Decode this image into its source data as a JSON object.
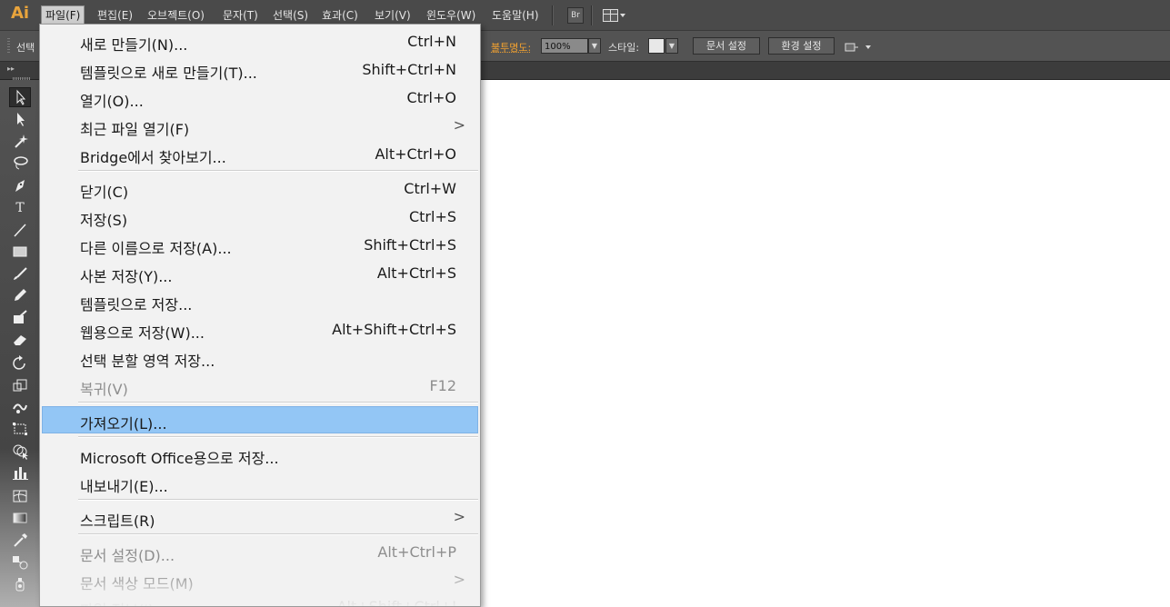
{
  "app": {
    "logo": "Ai"
  },
  "menubar": {
    "items": [
      "파일(F)",
      "편집(E)",
      "오브젝트(O)",
      "문자(T)",
      "선택(S)",
      "효과(C)",
      "보기(V)",
      "윈도우(W)",
      "도움말(H)"
    ],
    "bridge_button": "Br",
    "workspace_icon": "layout-icon"
  },
  "controlbar": {
    "selection_label": "선택",
    "opacity_label": "불투명도:",
    "opacity_value": "100%",
    "style_label": "스타일:",
    "document_setup": "문서 설정",
    "preferences": "환경 설정",
    "arrange_icon": "arrange-icon"
  },
  "file_menu": {
    "items": [
      {
        "label": "새로 만들기(N)...",
        "shortcut": "Ctrl+N"
      },
      {
        "label": "템플릿으로 새로 만들기(T)...",
        "shortcut": "Shift+Ctrl+N"
      },
      {
        "label": "열기(O)...",
        "shortcut": "Ctrl+O"
      },
      {
        "label": "최근 파일 열기(F)",
        "shortcut": "",
        "submenu": ">"
      },
      {
        "label": "Bridge에서 찾아보기...",
        "shortcut": "Alt+Ctrl+O"
      },
      {
        "label": "닫기(C)",
        "shortcut": "Ctrl+W"
      },
      {
        "label": "저장(S)",
        "shortcut": "Ctrl+S"
      },
      {
        "label": "다른 이름으로 저장(A)...",
        "shortcut": "Shift+Ctrl+S"
      },
      {
        "label": "사본 저장(Y)...",
        "shortcut": "Alt+Ctrl+S"
      },
      {
        "label": "템플릿으로 저장...",
        "shortcut": ""
      },
      {
        "label": "웹용으로 저장(W)...",
        "shortcut": "Alt+Shift+Ctrl+S"
      },
      {
        "label": "선택 분할 영역 저장...",
        "shortcut": ""
      },
      {
        "label": "복귀(V)",
        "shortcut": "F12",
        "disabled": true
      },
      {
        "label": "가져오기(L)...",
        "shortcut": "",
        "highlighted": true
      },
      {
        "label": "Microsoft Office용으로 저장...",
        "shortcut": ""
      },
      {
        "label": "내보내기(E)...",
        "shortcut": ""
      },
      {
        "label": "스크립트(R)",
        "shortcut": "",
        "submenu": ">"
      },
      {
        "label": "문서 설정(D)...",
        "shortcut": "Alt+Ctrl+P",
        "disabled": true
      },
      {
        "label": "문서 색상 모드(M)",
        "shortcut": "",
        "submenu": ">",
        "disabled": true
      },
      {
        "label": "파일 정보(I)...",
        "shortcut": "Alt+Shift+Ctrl+I",
        "disabled": true
      }
    ]
  },
  "tools": [
    "selection-tool",
    "direct-selection-tool",
    "magic-wand-tool",
    "lasso-tool",
    "pen-tool",
    "type-tool",
    "line-tool",
    "rectangle-tool",
    "paintbrush-tool",
    "pencil-tool",
    "blob-brush-tool",
    "eraser-tool",
    "rotate-tool",
    "scale-tool",
    "warp-tool",
    "free-transform-tool",
    "shape-builder-tool",
    "graph-tool",
    "mesh-tool",
    "gradient-tool",
    "eyedropper-tool",
    "blend-tool",
    "symbol-sprayer-tool"
  ],
  "tool_glyphs": {
    "type": "T"
  },
  "colors": {
    "accent_logo": "#e8a43c",
    "menu_highlight": "#93c6f5",
    "opacity_label": "#f0a030"
  }
}
